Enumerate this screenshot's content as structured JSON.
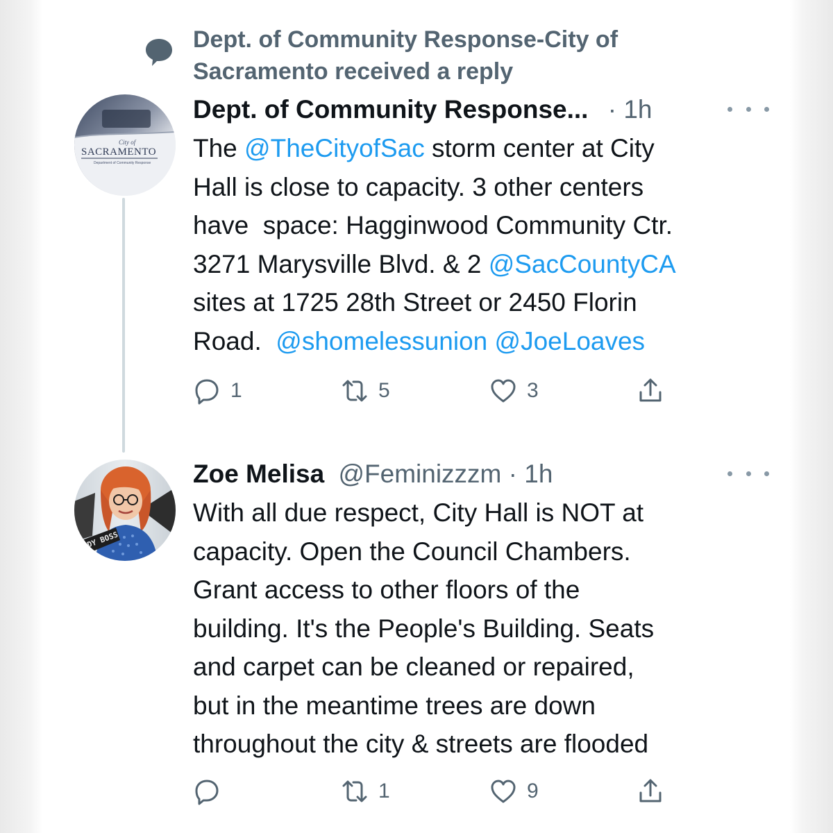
{
  "colors": {
    "text": "#0f1419",
    "secondary": "#536471",
    "link": "#1d9bf0",
    "thread_line": "#cfd9de"
  },
  "context": {
    "icon": "speech-bubble-icon",
    "line1": "Dept. of Community Response-City of",
    "line2": "Sacramento received a reply"
  },
  "tweets": [
    {
      "avatar": "city-of-sacramento-logo",
      "avatar_text": {
        "line1": "City of",
        "line2": "SACRAMENTO",
        "line3": "Department of Community Response"
      },
      "name": "Dept. of Community Response...",
      "time": "· 1h",
      "text_parts": [
        "The ",
        "@TheCityofSac",
        " storm center at City\nHall is close to capacity. 3 other centers\nhave  space: Hagginwood Community Ctr.\n3271 Marysville Blvd. & 2 ",
        "@SacCountyCA",
        "\nsites at 1725 28th Street or 2450 Florin\nRoad.  ",
        "@shomelessunion",
        " ",
        "@JoeLoaves"
      ],
      "actions": {
        "reply_count": "1",
        "retweet_count": "5",
        "like_count": "3"
      }
    },
    {
      "avatar": "profile-photo",
      "avatar_text": {
        "sign": "NDY BOSS"
      },
      "name": "Zoe Melisa",
      "handle": "@Feminizzzm",
      "time": "· 1h",
      "text": "With all due respect, City Hall is NOT at\ncapacity. Open the Council Chambers.\nGrant access to other floors of the\nbuilding. It's the People's Building. Seats\nand carpet can be cleaned or repaired,\nbut in the meantime trees are down\nthroughout the city & streets are flooded",
      "actions": {
        "reply_count": "",
        "retweet_count": "1",
        "like_count": "9"
      }
    }
  ]
}
